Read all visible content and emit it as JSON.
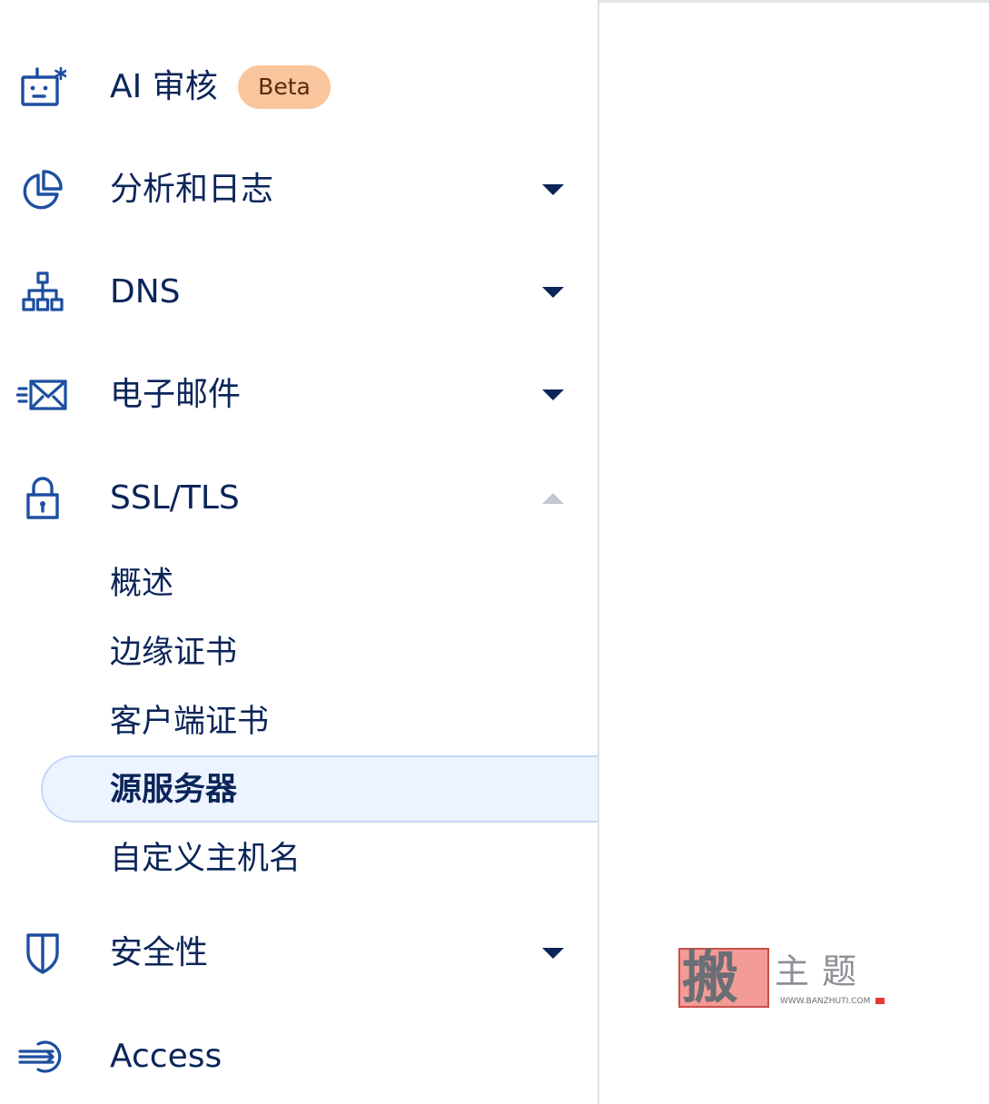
{
  "sidebar": {
    "items": [
      {
        "label": "AI 审核",
        "icon": "ai-robot-icon",
        "badge": "Beta"
      },
      {
        "label": "分析和日志",
        "icon": "pie-chart-icon",
        "expand": "collapsed"
      },
      {
        "label": "DNS",
        "icon": "network-hierarchy-icon",
        "expand": "collapsed"
      },
      {
        "label": "电子邮件",
        "icon": "email-icon",
        "expand": "collapsed"
      },
      {
        "label": "SSL/TLS",
        "icon": "lock-icon",
        "expand": "expanded"
      },
      {
        "label": "安全性",
        "icon": "shield-icon",
        "expand": "collapsed"
      },
      {
        "label": "Access",
        "icon": "access-sign-in-icon"
      }
    ],
    "ssl_sub_items": [
      {
        "label": "概述"
      },
      {
        "label": "边缘证书"
      },
      {
        "label": "客户端证书"
      },
      {
        "label": "源服务器",
        "active": true
      },
      {
        "label": "自定义主机名"
      }
    ]
  },
  "watermark": {
    "logo_char": "搬",
    "title": "主题",
    "url": "WWW.BANZHUTI.COM"
  },
  "colors": {
    "text": "#0b2559",
    "icon": "#1d4fa0",
    "badge_bg": "#f9c59c",
    "active_bg": "#edf3ff",
    "active_border": "#c5d6f5",
    "divider": "#dfe1e5"
  }
}
